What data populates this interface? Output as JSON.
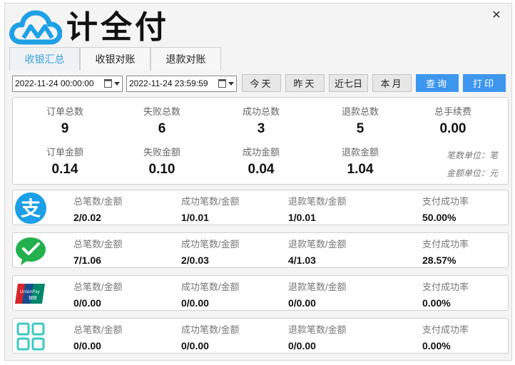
{
  "app": {
    "title": "计全付",
    "close_glyph": "✕"
  },
  "tabs": [
    {
      "label": "收银汇总",
      "active": true
    },
    {
      "label": "收银对账",
      "active": false
    },
    {
      "label": "退款对账",
      "active": false
    }
  ],
  "toolbar": {
    "start_date": "2022-11-24 00:00:00",
    "end_date": "2022-11-24 23:59:59",
    "buttons": {
      "today": "今天",
      "yesterday": "昨天",
      "last7": "近七日",
      "month": "本月",
      "query": "查询",
      "print": "打印"
    }
  },
  "summary": {
    "order_count": {
      "label": "订单总数",
      "value": "9"
    },
    "fail_count": {
      "label": "失败总数",
      "value": "6"
    },
    "success_count": {
      "label": "成功总数",
      "value": "3"
    },
    "refund_count": {
      "label": "退款总数",
      "value": "5"
    },
    "total_fee": {
      "label": "总手续费",
      "value": "0.00"
    },
    "order_amount": {
      "label": "订单金额",
      "value": "0.14"
    },
    "fail_amount": {
      "label": "失败金额",
      "value": "0.10"
    },
    "success_amount": {
      "label": "成功金额",
      "value": "0.04"
    },
    "refund_amount": {
      "label": "退款金额",
      "value": "1.04"
    },
    "unit_count": "笔数单位：笔",
    "unit_amount": "金额单位：元"
  },
  "column_labels": {
    "total": "总笔数/金额",
    "success": "成功笔数/金额",
    "refund": "退款笔数/金额",
    "rate": "支付成功率"
  },
  "payment_methods": [
    {
      "icon": "alipay-icon",
      "total": "2/0.02",
      "success": "1/0.01",
      "refund": "1/0.01",
      "rate": "50.00%"
    },
    {
      "icon": "wechat-pay-icon",
      "total": "7/1.06",
      "success": "2/0.03",
      "refund": "4/1.03",
      "rate": "28.57%"
    },
    {
      "icon": "unionpay-icon",
      "total": "0/0.00",
      "success": "0/0.00",
      "refund": "0/0.00",
      "rate": "0.00%"
    },
    {
      "icon": "other-payment-icon",
      "total": "0/0.00",
      "success": "0/0.00",
      "refund": "0/0.00",
      "rate": "0.00%"
    }
  ],
  "colors": {
    "accent": "#3d97ef",
    "alipay": "#1a9fe8",
    "wechat": "#22b14c",
    "grid": "#3cc9c0"
  }
}
